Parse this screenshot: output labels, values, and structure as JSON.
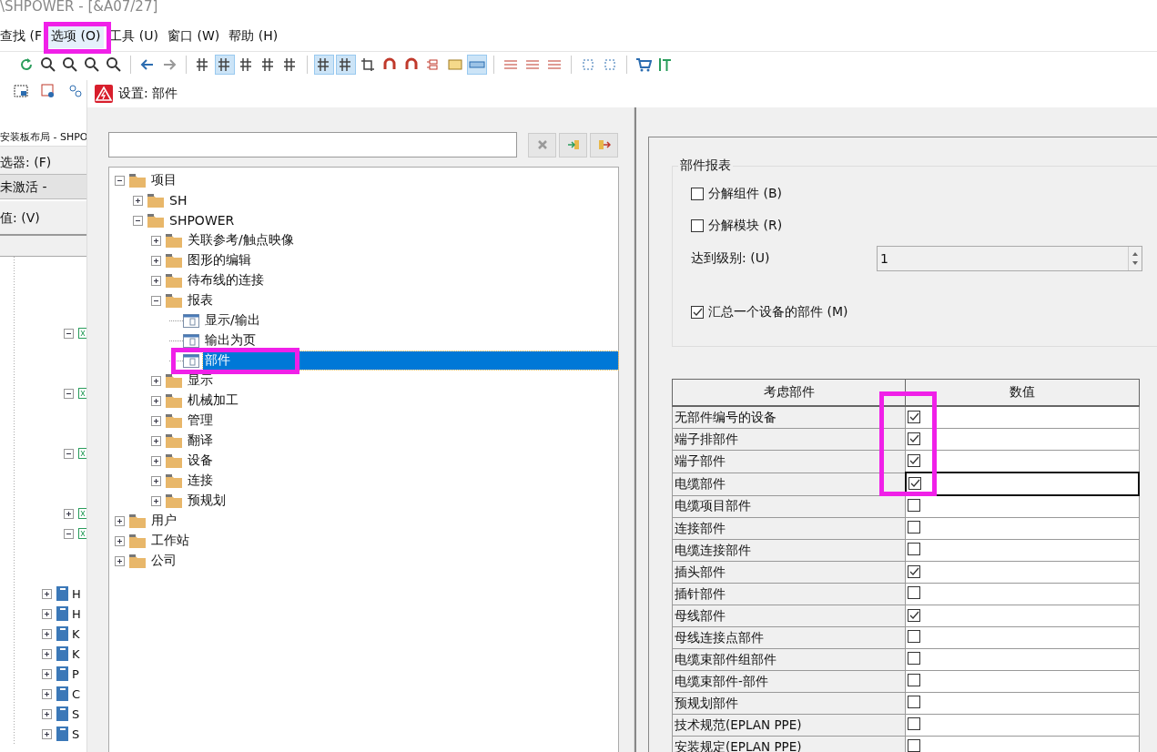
{
  "app": {
    "title": "\\SHPOWER - [&A07/27]",
    "menu": [
      {
        "label": "查找 (F",
        "selected": false
      },
      {
        "label": "选项 (O)",
        "selected": true
      },
      {
        "label": "工具 (U)",
        "selected": false
      },
      {
        "label": "窗口 (W)",
        "selected": false
      },
      {
        "label": "帮助 (H)",
        "selected": false
      }
    ],
    "side_panel": {
      "tab": "安装板布局 - SHPO",
      "filter_label": "选器: (F)",
      "filter_value": "未激活 -",
      "value_label": "值: (V)",
      "tree": [
        {
          "kind": "node",
          "expanded": true
        },
        {
          "kind": "node",
          "expanded": true
        },
        {
          "kind": "node",
          "expanded": true
        },
        {
          "kind": "node",
          "expanded": false
        },
        {
          "kind": "node",
          "expanded": true
        },
        {
          "kind": "book",
          "label": "H",
          "expanded": false
        },
        {
          "kind": "book",
          "label": "H",
          "expanded": false
        },
        {
          "kind": "book",
          "label": "K",
          "expanded": false
        },
        {
          "kind": "book",
          "label": "K",
          "expanded": false
        },
        {
          "kind": "book",
          "label": "P",
          "expanded": false
        },
        {
          "kind": "book",
          "label": "C",
          "expanded": false
        },
        {
          "kind": "book",
          "label": "S",
          "expanded": false
        },
        {
          "kind": "book",
          "label": "S",
          "expanded": false
        }
      ]
    }
  },
  "dialog": {
    "title": "设置: 部件",
    "tree": [
      {
        "label": "项目",
        "kind": "folder",
        "expanded": true,
        "selected": false,
        "children": [
          {
            "label": "SH",
            "kind": "folder",
            "expanded": false,
            "selected": false
          },
          {
            "label": "SHPOWER",
            "kind": "folder",
            "expanded": true,
            "selected": false,
            "children": [
              {
                "label": "关联参考/触点映像",
                "kind": "folder",
                "expanded": false,
                "selected": false
              },
              {
                "label": "图形的编辑",
                "kind": "folder",
                "expanded": false,
                "selected": false
              },
              {
                "label": "待布线的连接",
                "kind": "folder",
                "expanded": false,
                "selected": false
              },
              {
                "label": "报表",
                "kind": "folder",
                "expanded": true,
                "selected": false,
                "children": [
                  {
                    "label": "显示/输出",
                    "kind": "page",
                    "selected": false
                  },
                  {
                    "label": "输出为页",
                    "kind": "page",
                    "selected": false
                  },
                  {
                    "label": "部件",
                    "kind": "page",
                    "selected": true
                  }
                ]
              },
              {
                "label": "显示",
                "kind": "folder",
                "expanded": false,
                "selected": false
              },
              {
                "label": "机械加工",
                "kind": "folder",
                "expanded": false,
                "selected": false
              },
              {
                "label": "管理",
                "kind": "folder",
                "expanded": false,
                "selected": false
              },
              {
                "label": "翻译",
                "kind": "folder",
                "expanded": false,
                "selected": false
              },
              {
                "label": "设备",
                "kind": "folder",
                "expanded": false,
                "selected": false
              },
              {
                "label": "连接",
                "kind": "folder",
                "expanded": false,
                "selected": false
              },
              {
                "label": "预规划",
                "kind": "folder",
                "expanded": false,
                "selected": false
              }
            ]
          }
        ]
      },
      {
        "label": "用户",
        "kind": "folder",
        "expanded": false,
        "selected": false
      },
      {
        "label": "工作站",
        "kind": "folder",
        "expanded": false,
        "selected": false
      },
      {
        "label": "公司",
        "kind": "folder",
        "expanded": false,
        "selected": false
      }
    ],
    "group": {
      "title": "部件报表",
      "options": [
        {
          "label": "分解组件 (B)",
          "checked": false
        },
        {
          "label": "分解模块 (R)",
          "checked": false
        }
      ],
      "level_label": "达到级别: (U)",
      "level_value": "1",
      "summary": {
        "label": "汇总一个设备的部件 (M)",
        "checked": true
      }
    },
    "table": {
      "columns": [
        "考虑部件",
        "数值"
      ],
      "rows": [
        {
          "label": "无部件编号的设备",
          "checked": true,
          "focused": false
        },
        {
          "label": "端子排部件",
          "checked": true,
          "focused": false
        },
        {
          "label": "端子部件",
          "checked": true,
          "focused": false
        },
        {
          "label": "电缆部件",
          "checked": true,
          "focused": true
        },
        {
          "label": "电缆项目部件",
          "checked": false,
          "focused": false
        },
        {
          "label": "连接部件",
          "checked": false,
          "focused": false
        },
        {
          "label": "电缆连接部件",
          "checked": false,
          "focused": false
        },
        {
          "label": "插头部件",
          "checked": true,
          "focused": false
        },
        {
          "label": "插针部件",
          "checked": false,
          "focused": false
        },
        {
          "label": "母线部件",
          "checked": true,
          "focused": false
        },
        {
          "label": "母线连接点部件",
          "checked": false,
          "focused": false
        },
        {
          "label": "电缆束部件组部件",
          "checked": false,
          "focused": false
        },
        {
          "label": "电缆束部件-部件",
          "checked": false,
          "focused": false
        },
        {
          "label": "预规划部件",
          "checked": false,
          "focused": false
        },
        {
          "label": "技术规范(EPLAN PPE)",
          "checked": false,
          "focused": false
        },
        {
          "label": "安装规定(EPLAN PPE)",
          "checked": false,
          "focused": false
        }
      ]
    }
  }
}
